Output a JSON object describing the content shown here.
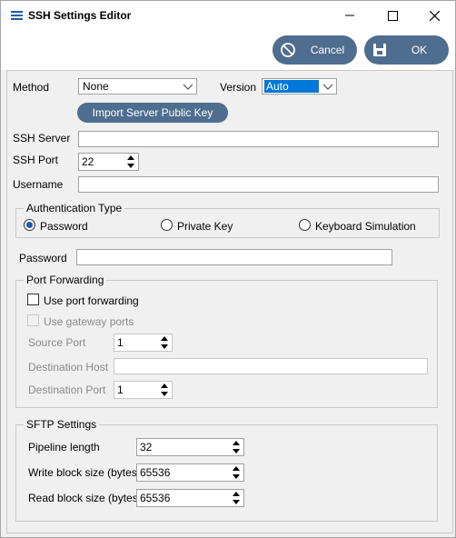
{
  "window": {
    "title": "SSH Settings Editor",
    "minimize_icon": "minimize-icon",
    "maximize_icon": "maximize-icon",
    "close_icon": "close-icon"
  },
  "toolbar": {
    "cancel_label": "Cancel",
    "ok_label": "OK",
    "cancel_icon": "cancel-circle-icon",
    "ok_icon": "save-icon",
    "accent": "#4f6d8e"
  },
  "form": {
    "method_label": "Method",
    "method_value": "None",
    "version_label": "Version",
    "version_value": "Auto",
    "import_key_label": "Import Server Public Key",
    "ssh_server_label": "SSH Server",
    "ssh_server_value": "",
    "ssh_port_label": "SSH Port",
    "ssh_port_value": "22",
    "username_label": "Username",
    "username_value": "",
    "auth_group_title": "Authentication Type",
    "auth_options": [
      "Password",
      "Private Key",
      "Keyboard Simulation"
    ],
    "auth_selected": "Password",
    "password_label": "Password",
    "password_value": ""
  },
  "port_forwarding": {
    "title": "Port Forwarding",
    "use_port_forwarding_label": "Use port forwarding",
    "use_gateway_ports_label": "Use gateway ports",
    "source_port_label": "Source Port",
    "source_port_value": "1",
    "destination_host_label": "Destination Host",
    "destination_host_value": "",
    "destination_port_label": "Destination Port",
    "destination_port_value": "1"
  },
  "sftp": {
    "title": "SFTP Settings",
    "pipeline_length_label": "Pipeline length",
    "pipeline_length_value": "32",
    "write_block_label": "Write block size (bytes)",
    "write_block_value": "65536",
    "read_block_label": "Read block size (bytes)",
    "read_block_value": "65536"
  }
}
